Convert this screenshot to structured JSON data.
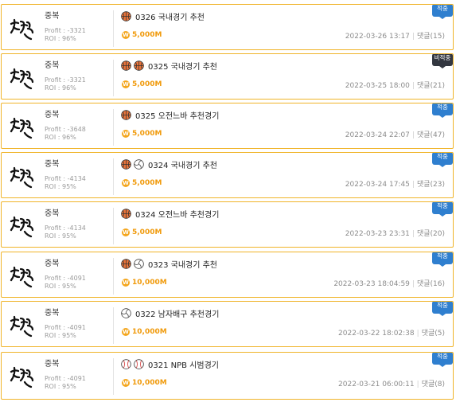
{
  "colors": {
    "accent_border": "#f0b429",
    "amount": "#f09a0b",
    "badge_hit": "#2f7fcf",
    "badge_miss": "#333740"
  },
  "posts": [
    {
      "author": "중복",
      "profit_label": "Profit : -3321",
      "roi_label": "ROI : 96%",
      "icons": [
        "basketball-icon"
      ],
      "title": "0326 국내경기 추천",
      "amount": "5,000M",
      "date": "2022-03-26 13:17",
      "comments": "댓글(15)",
      "badge": "적중",
      "badge_type": "hit"
    },
    {
      "author": "중복",
      "profit_label": "Profit : -3321",
      "roi_label": "ROI : 96%",
      "icons": [
        "basketball-icon",
        "basketball-icon"
      ],
      "title": "0325 국내경기 추천",
      "amount": "5,000M",
      "date": "2022-03-25 18:00",
      "comments": "댓글(21)",
      "badge": "비적중",
      "badge_type": "miss"
    },
    {
      "author": "중복",
      "profit_label": "Profit : -3648",
      "roi_label": "ROI : 96%",
      "icons": [
        "basketball-icon"
      ],
      "title": "0325 오전느바 추천경기",
      "amount": "5,000M",
      "date": "2022-03-24 22:07",
      "comments": "댓글(47)",
      "badge": "적중",
      "badge_type": "hit"
    },
    {
      "author": "중복",
      "profit_label": "Profit : -4134",
      "roi_label": "ROI : 95%",
      "icons": [
        "basketball-icon",
        "volleyball-icon"
      ],
      "title": "0324 국내경기 추천",
      "amount": "5,000M",
      "date": "2022-03-24 17:45",
      "comments": "댓글(23)",
      "badge": "적중",
      "badge_type": "hit"
    },
    {
      "author": "중복",
      "profit_label": "Profit : -4134",
      "roi_label": "ROI : 95%",
      "icons": [
        "basketball-icon"
      ],
      "title": "0324 오전느바 추천경기",
      "amount": "5,000M",
      "date": "2022-03-23 23:31",
      "comments": "댓글(20)",
      "badge": "적중",
      "badge_type": "hit"
    },
    {
      "author": "중복",
      "profit_label": "Profit : -4091",
      "roi_label": "ROI : 95%",
      "icons": [
        "basketball-icon",
        "volleyball-icon"
      ],
      "title": "0323 국내경기 추천",
      "amount": "10,000M",
      "date": "2022-03-23 18:04:59",
      "comments": "댓글(16)",
      "badge": "적중",
      "badge_type": "hit"
    },
    {
      "author": "중복",
      "profit_label": "Profit : -4091",
      "roi_label": "ROI : 95%",
      "icons": [
        "volleyball-icon"
      ],
      "title": "0322 남자배구 추천경기",
      "amount": "10,000M",
      "date": "2022-03-22 18:02:38",
      "comments": "댓글(5)",
      "badge": "적중",
      "badge_type": "hit"
    },
    {
      "author": "중복",
      "profit_label": "Profit : -4091",
      "roi_label": "ROI : 95%",
      "icons": [
        "baseball-icon",
        "baseball-icon"
      ],
      "title": "0321 NPB 시범경기",
      "amount": "10,000M",
      "date": "2022-03-21 06:00:11",
      "comments": "댓글(8)",
      "badge": "적중",
      "badge_type": "hit"
    }
  ]
}
